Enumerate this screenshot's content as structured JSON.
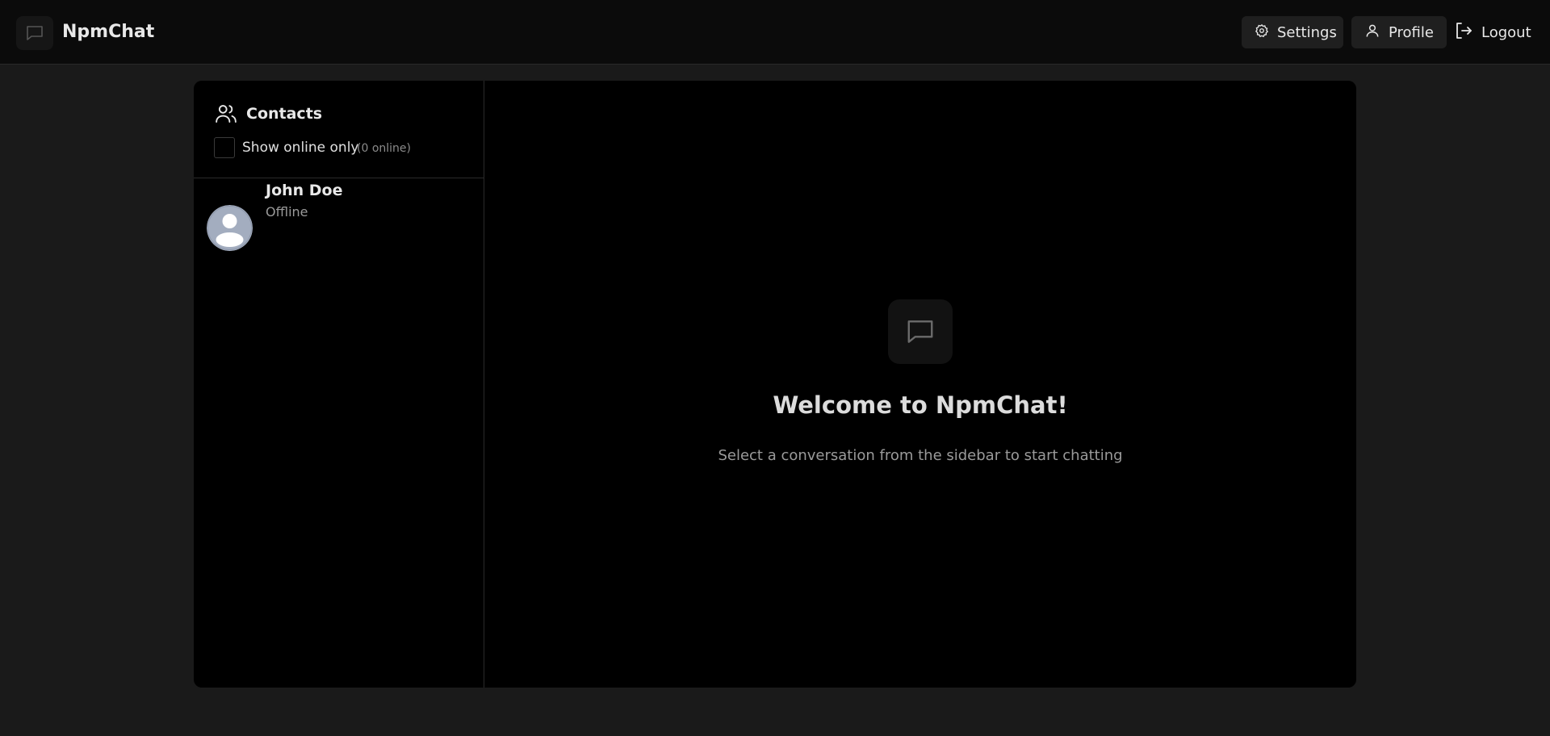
{
  "header": {
    "app_title": "NpmChat",
    "logo_icon": "message-square-icon",
    "settings_label": "Settings",
    "profile_label": "Profile",
    "logout_label": "Logout"
  },
  "sidebar": {
    "title": "Contacts",
    "title_icon": "users-icon",
    "filter": {
      "label": "Show online only",
      "checked": false,
      "count_text": "(0 online)"
    },
    "contacts": [
      {
        "name": "John Doe",
        "status": "Offline",
        "avatar_icon": "default-user-avatar"
      }
    ]
  },
  "main": {
    "icon": "message-square-icon",
    "title": "Welcome to NpmChat!",
    "subtitle": "Select a conversation from the sidebar to start chatting"
  },
  "colors": {
    "page_bg": "#1a1a1a",
    "header_bg": "#0b0b0b",
    "card_bg": "#000000",
    "button_bg": "#1f1f1f",
    "text_primary": "#e8e8e8",
    "text_muted": "#9a9a9a",
    "avatar_bg": "#a3adbf"
  }
}
